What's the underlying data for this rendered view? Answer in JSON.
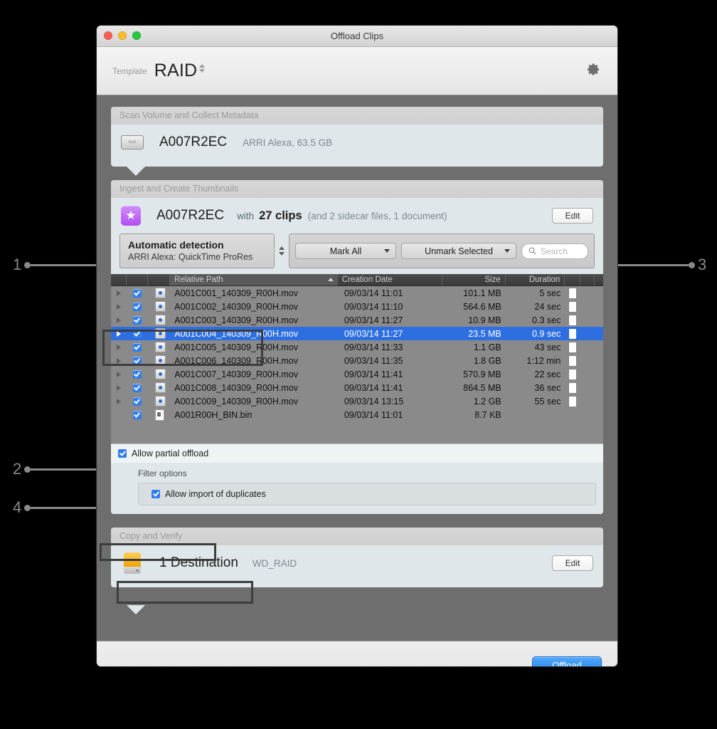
{
  "window": {
    "title": "Offload Clips",
    "traffic_lights": [
      "close",
      "minimize",
      "zoom"
    ]
  },
  "toolbar": {
    "template_label": "Template",
    "template_value": "RAID",
    "gear_icon": "gear-icon"
  },
  "sections": {
    "scan": {
      "header": "Scan Volume and Collect Metadata",
      "icon": "sxs-card-icon",
      "icon_text": "SxS",
      "volume_name": "A007R2EC",
      "volume_meta": "ARRI Alexa, 63.5 GB"
    },
    "ingest": {
      "header": "Ingest and Create Thumbnails",
      "icon": "star-icon",
      "volume_name": "A007R2EC",
      "with_label": "with",
      "clips_count": "27 clips",
      "extra": "(and 2 sidecar files, 1 document)",
      "edit_label": "Edit"
    },
    "copy": {
      "header": "Copy and Verify",
      "icon": "hard-drive-icon",
      "destination": "1 Destination",
      "destination_meta": "WD_RAID",
      "edit_label": "Edit"
    }
  },
  "detection": {
    "title": "Automatic detection",
    "subtitle": "ARRI Alexa: QuickTime ProRes"
  },
  "controls": {
    "mark_all": "Mark All",
    "unmark_selected": "Unmark Selected",
    "search_placeholder": "Search"
  },
  "table": {
    "columns": [
      "Relative Path",
      "Creation Date",
      "Size",
      "Duration"
    ],
    "sorted_column": "Relative Path",
    "sort_direction": "ascending",
    "rows": [
      {
        "disclosure": true,
        "checked": true,
        "icon": "mov-file-icon",
        "path": "A001C001_140309_R00H.mov",
        "date": "09/03/14 11:01",
        "size": "101.1 MB",
        "duration": "5 sec",
        "doc": true,
        "flag": true,
        "selected": false
      },
      {
        "disclosure": true,
        "checked": true,
        "icon": "mov-file-icon",
        "path": "A001C002_140309_R00H.mov",
        "date": "09/03/14 11:10",
        "size": "564.6 MB",
        "duration": "24 sec",
        "doc": true,
        "flag": true,
        "selected": false
      },
      {
        "disclosure": true,
        "checked": true,
        "icon": "mov-file-icon",
        "path": "A001C003_140309_R00H.mov",
        "date": "09/03/14 11:27",
        "size": "10.9 MB",
        "duration": "0.3 sec",
        "doc": true,
        "flag": true,
        "selected": false
      },
      {
        "disclosure": true,
        "checked": true,
        "icon": "mov-file-icon",
        "path": "A001C004_140309_R00H.mov",
        "date": "09/03/14 11:27",
        "size": "23.5 MB",
        "duration": "0.9 sec",
        "doc": true,
        "flag": true,
        "selected": true
      },
      {
        "disclosure": true,
        "checked": true,
        "icon": "mov-file-icon",
        "path": "A001C005_140309_R00H.mov",
        "date": "09/03/14 11:33",
        "size": "1.1 GB",
        "duration": "43 sec",
        "doc": true,
        "flag": true,
        "selected": false
      },
      {
        "disclosure": true,
        "checked": true,
        "icon": "mov-file-icon",
        "path": "A001C006_140309_R00H.mov",
        "date": "09/03/14 11:35",
        "size": "1.8 GB",
        "duration": "1:12 min",
        "doc": true,
        "flag": true,
        "selected": false
      },
      {
        "disclosure": true,
        "checked": true,
        "icon": "mov-file-icon",
        "path": "A001C007_140309_R00H.mov",
        "date": "09/03/14 11:41",
        "size": "570.9 MB",
        "duration": "22 sec",
        "doc": true,
        "flag": true,
        "selected": false
      },
      {
        "disclosure": true,
        "checked": true,
        "icon": "mov-file-icon",
        "path": "A001C008_140309_R00H.mov",
        "date": "09/03/14 11:41",
        "size": "864.5 MB",
        "duration": "36 sec",
        "doc": true,
        "flag": true,
        "selected": false
      },
      {
        "disclosure": true,
        "checked": true,
        "icon": "mov-file-icon",
        "path": "A001C009_140309_R00H.mov",
        "date": "09/03/14 13:15",
        "size": "1.2 GB",
        "duration": "55 sec",
        "doc": true,
        "flag": true,
        "selected": false
      },
      {
        "disclosure": false,
        "checked": true,
        "icon": "bin-file-icon",
        "path": "A001R00H_BIN.bin",
        "date": "09/03/14 11:01",
        "size": "8.7 KB",
        "duration": "",
        "doc": false,
        "flag": true,
        "selected": false
      }
    ]
  },
  "options": {
    "allow_partial_offload": "Allow partial offload",
    "allow_partial_offload_checked": true,
    "filter_options_title": "Filter options",
    "allow_import_duplicates": "Allow import of duplicates",
    "allow_import_duplicates_checked": true
  },
  "footer": {
    "offload_label": "Offload"
  },
  "callouts": [
    {
      "number": "1",
      "side": "left",
      "target": "automatic-detection-box"
    },
    {
      "number": "2",
      "side": "left",
      "target": "allow-partial-offload"
    },
    {
      "number": "3",
      "side": "right",
      "target": "mark-controls-bar"
    },
    {
      "number": "4",
      "side": "left",
      "target": "allow-import-of-duplicates"
    }
  ],
  "colors": {
    "accent_blue": "#2d6fe0",
    "button_blue": "#1a7df0",
    "flag_orange": "#f5a623",
    "star_purple": "#b44cf0",
    "panel_bg": "#dfe7ea",
    "window_body": "#6e6e6e"
  }
}
